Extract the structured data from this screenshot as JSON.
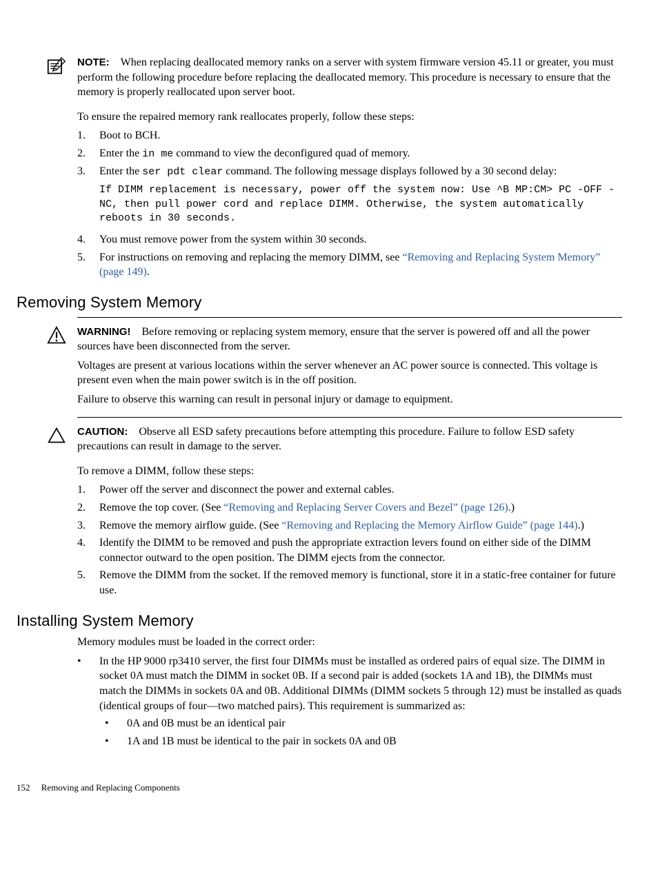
{
  "note": {
    "label": "NOTE:",
    "text": "When replacing deallocated memory ranks on a server with system firmware version 45.11 or greater, you must perform the following procedure before replacing the deallocated memory. This procedure is necessary to ensure that the memory is properly reallocated upon server boot."
  },
  "ensure_intro": "To ensure the repaired memory rank reallocates properly, follow these steps:",
  "ensure_steps": {
    "s1": {
      "num": "1.",
      "text": "Boot to BCH."
    },
    "s2": {
      "num": "2.",
      "pre": "Enter the ",
      "code": "in me",
      "post": " command to view the deconfigured quad of memory."
    },
    "s3": {
      "num": "3.",
      "pre": "Enter the ",
      "code": "ser pdt clear",
      "post": " command. The following message displays followed by a 30 second delay:",
      "block": "If DIMM replacement is necessary, power off the system now: Use ^B MP:CM> PC -OFF -NC, then pull power cord and replace DIMM. Otherwise, the system automatically reboots in 30 seconds."
    },
    "s4": {
      "num": "4.",
      "text": "You must remove power from the system within 30 seconds."
    },
    "s5": {
      "num": "5.",
      "pre": "For instructions on removing and replacing the memory DIMM, see ",
      "link": "“Removing and Replacing System Memory” (page 149)",
      "post": "."
    }
  },
  "section_removing": {
    "title": "Removing System Memory",
    "warning": {
      "label": "WARNING!",
      "p1": "Before removing or replacing system memory, ensure that the server is powered off and all the power sources have been disconnected from the server.",
      "p2": "Voltages are present at various locations within the server whenever an AC power source is connected. This voltage is present even when the main power switch is in the off position.",
      "p3": "Failure to observe this warning can result in personal injury or damage to equipment."
    },
    "caution": {
      "label": "CAUTION:",
      "text": "Observe all ESD safety precautions before attempting this procedure. Failure to follow ESD safety precautions can result in damage to the server."
    },
    "intro": "To remove a DIMM, follow these steps:",
    "steps": {
      "s1": {
        "num": "1.",
        "text": "Power off the server and disconnect the power and external cables."
      },
      "s2": {
        "num": "2.",
        "pre": "Remove the top cover. (See ",
        "link": "“Removing and Replacing Server Covers and Bezel” (page 126)",
        "post": ".)"
      },
      "s3": {
        "num": "3.",
        "pre": "Remove the memory airflow guide. (See ",
        "link": "“Removing and Replacing the Memory Airflow Guide” (page 144)",
        "post": ".)"
      },
      "s4": {
        "num": "4.",
        "text": "Identify the DIMM to be removed and push the appropriate extraction levers found on either side of the DIMM connector outward to the open position. The DIMM ejects from the connector."
      },
      "s5": {
        "num": "5.",
        "text": "Remove the DIMM from the socket. If the removed memory is functional, store it in a static-free container for future use."
      }
    }
  },
  "section_installing": {
    "title": "Installing System Memory",
    "intro": "Memory modules must be loaded in the correct order:",
    "bullets": {
      "b1": {
        "text": "In the HP 9000 rp3410 server, the first four DIMMs must be installed as ordered pairs of equal size. The DIMM in socket 0A must match the DIMM in socket 0B. If a second pair is added (sockets 1A and 1B), the DIMMs must match the DIMMs in sockets 0A and 0B. Additional DIMMs (DIMM sockets 5 through 12) must be installed as quads (identical groups of four—two matched pairs). This requirement is summarized as:",
        "sub": {
          "sb1": "0A and 0B must be an identical pair",
          "sb2": "1A and 1B must be identical to the pair in sockets 0A and 0B"
        }
      }
    }
  },
  "footer": {
    "page": "152",
    "title": "Removing and Replacing Components"
  }
}
